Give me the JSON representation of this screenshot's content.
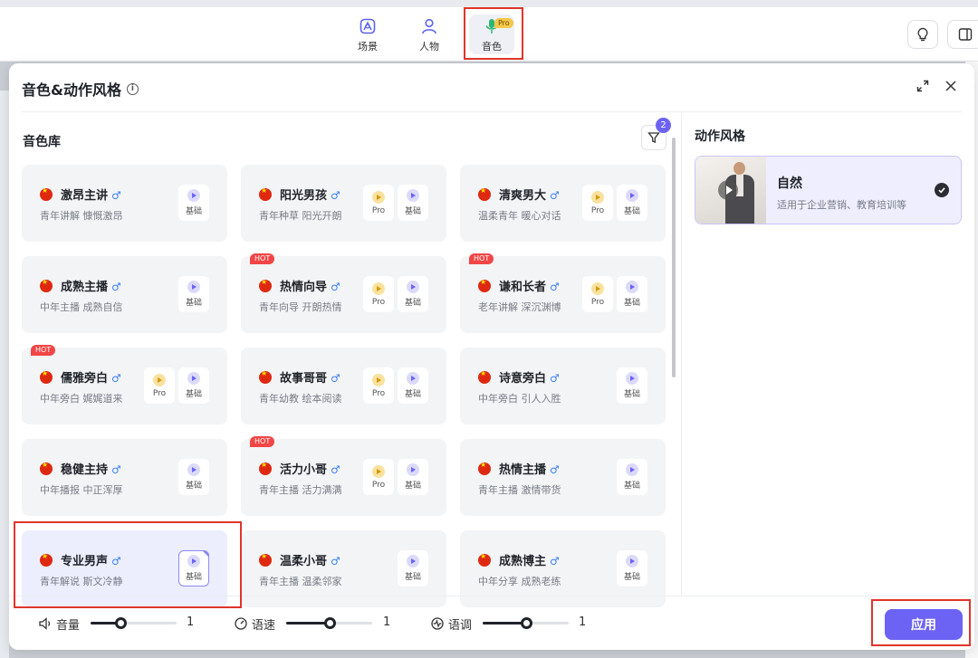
{
  "nav": {
    "tabs": [
      {
        "label": "场景",
        "icon": "scene-icon"
      },
      {
        "label": "人物",
        "icon": "person-icon"
      },
      {
        "label": "音色",
        "icon": "microphone-icon",
        "badge": "Pro"
      }
    ]
  },
  "modal": {
    "title": "音色&动作风格",
    "library_title": "音色库",
    "filter_count": "2",
    "voices": [
      {
        "name": "激昂主讲",
        "desc": "青年讲解 慷慨激昂",
        "hot": "",
        "buttons": [
          "基础"
        ]
      },
      {
        "name": "阳光男孩",
        "desc": "青年种草 阳光开朗",
        "hot": "",
        "buttons": [
          "Pro",
          "基础"
        ]
      },
      {
        "name": "清爽男大",
        "desc": "温柔青年 暖心对话",
        "hot": "",
        "buttons": [
          "Pro",
          "基础"
        ]
      },
      {
        "name": "成熟主播",
        "desc": "中年主播 成熟自信",
        "hot": "",
        "buttons": [
          "基础"
        ]
      },
      {
        "name": "热情向导",
        "desc": "青年向导 开朗热情",
        "hot": "HOT",
        "buttons": [
          "Pro",
          "基础"
        ]
      },
      {
        "name": "谦和长者",
        "desc": "老年讲解 深沉渊博",
        "hot": "HOT",
        "buttons": [
          "Pro",
          "基础"
        ]
      },
      {
        "name": "儒雅旁白",
        "desc": "中年旁白 娓娓道来",
        "hot": "HOT",
        "buttons": [
          "Pro",
          "基础"
        ]
      },
      {
        "name": "故事哥哥",
        "desc": "青年幼教 绘本阅读",
        "hot": "",
        "buttons": [
          "Pro",
          "基础"
        ]
      },
      {
        "name": "诗意旁白",
        "desc": "中年旁白 引人入胜",
        "hot": "",
        "buttons": [
          "基础"
        ]
      },
      {
        "name": "稳健主持",
        "desc": "中年播报 中正浑厚",
        "hot": "",
        "buttons": [
          "基础"
        ]
      },
      {
        "name": "活力小哥",
        "desc": "青年主播 活力满满",
        "hot": "HOT",
        "buttons": [
          "Pro",
          "基础"
        ]
      },
      {
        "name": "热情主播",
        "desc": "青年主播 激情带货",
        "hot": "",
        "buttons": [
          "基础"
        ]
      },
      {
        "name": "专业男声",
        "desc": "青年解说 斯文冷静",
        "hot": "",
        "buttons": [
          "基础"
        ],
        "selected": true
      },
      {
        "name": "温柔小哥",
        "desc": "青年主播 温柔邻家",
        "hot": "",
        "buttons": [
          "基础"
        ]
      },
      {
        "name": "成熟博主",
        "desc": "中年分享 成熟老练",
        "hot": "",
        "buttons": [
          "基础"
        ]
      }
    ],
    "male_symbol": "♂",
    "action": {
      "title": "动作风格",
      "name": "自然",
      "desc": "适用于企业营销、教育培训等"
    },
    "controls": [
      {
        "label": "音量",
        "icon": "volume-icon",
        "value": "1",
        "level": 0.35
      },
      {
        "label": "语速",
        "icon": "speed-icon",
        "value": "1",
        "level": 0.5
      },
      {
        "label": "语调",
        "icon": "pitch-icon",
        "value": "1",
        "level": 0.5
      }
    ],
    "apply_label": "应用"
  },
  "colors": {
    "accent": "#6c63f5",
    "hot": "#f24646",
    "highlight": "#e0352b"
  }
}
